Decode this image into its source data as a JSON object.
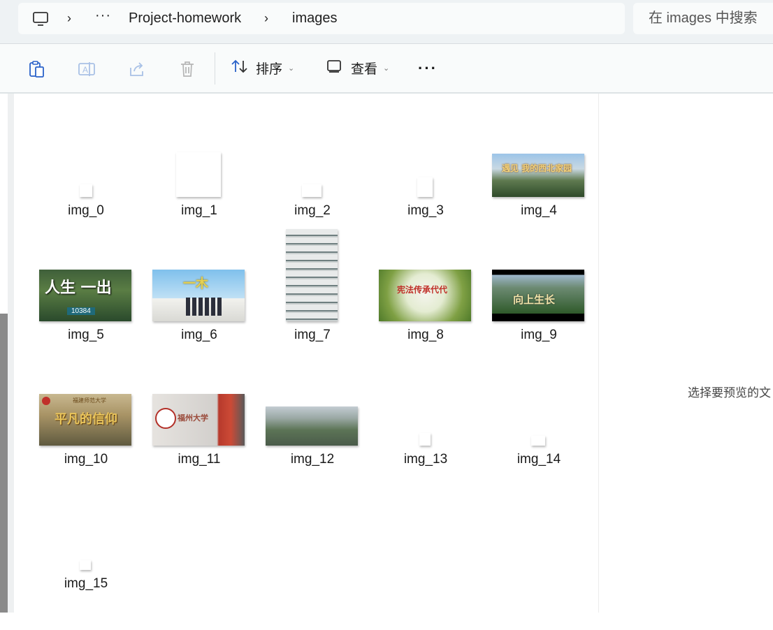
{
  "address_bar": {
    "breadcrumb": [
      {
        "label": "Project-homework"
      },
      {
        "label": "images"
      }
    ],
    "overflow_label": "···",
    "search_placeholder": "在 images 中搜索"
  },
  "toolbar": {
    "sort_label": "排序",
    "view_label": "查看",
    "more_label": "···"
  },
  "files": [
    {
      "name": "img_0"
    },
    {
      "name": "img_1"
    },
    {
      "name": "img_2"
    },
    {
      "name": "img_3"
    },
    {
      "name": "img_4",
      "overlay_text": "遇见 我的西北家园"
    },
    {
      "name": "img_5",
      "overlay_text": "人生  一出",
      "badge_text": "10384"
    },
    {
      "name": "img_6",
      "overlay_text": "一木"
    },
    {
      "name": "img_7"
    },
    {
      "name": "img_8",
      "overlay_text": "宪法传承代代"
    },
    {
      "name": "img_9",
      "overlay_text": "向上生长"
    },
    {
      "name": "img_10",
      "overlay_text": "平凡的信仰",
      "subtitle_text": "福建师范大学"
    },
    {
      "name": "img_11",
      "overlay_text": "福州大学"
    },
    {
      "name": "img_12"
    },
    {
      "name": "img_13"
    },
    {
      "name": "img_14"
    },
    {
      "name": "img_15"
    }
  ],
  "preview_pane": {
    "message": "选择要预览的文"
  },
  "colors": {
    "accent": "#2a62c9",
    "bar_bg": "#eef2f4",
    "toolbar_bg": "#f9fbfb"
  }
}
